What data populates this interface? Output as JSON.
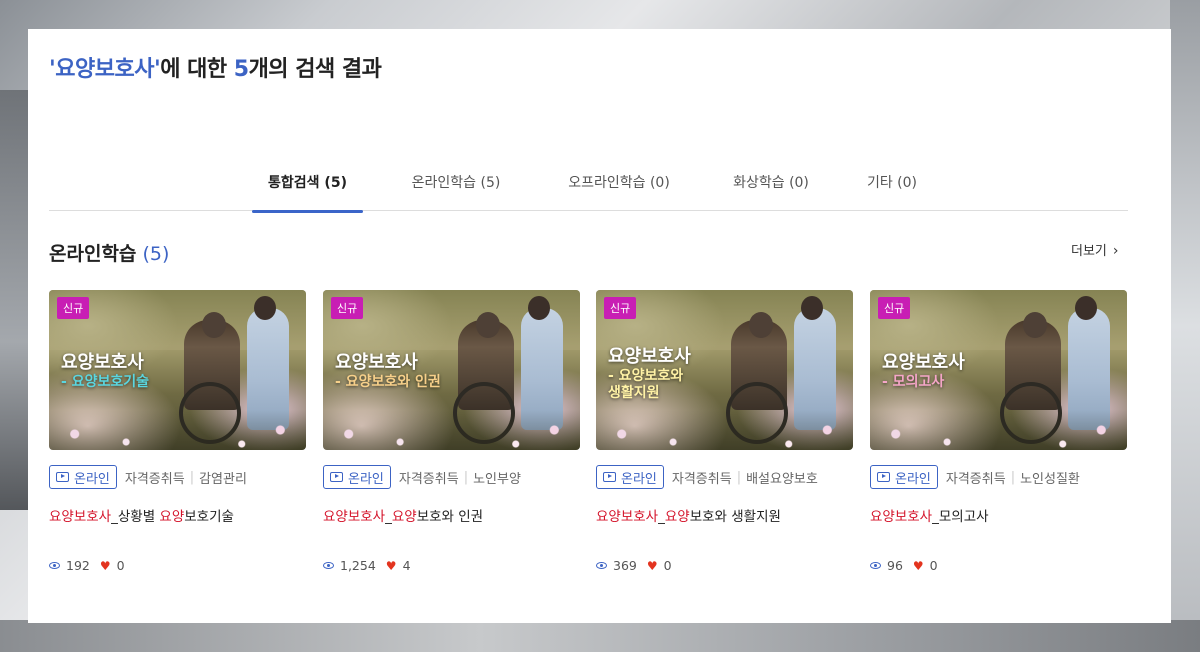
{
  "search": {
    "quote_open": "'",
    "keyword": "요양보호사",
    "quote_close": "'",
    "suffix_a": "에 대한 ",
    "count": "5",
    "suffix_b": "개의 검색 결과"
  },
  "tabs": [
    {
      "label": "통합검색 (5)",
      "active": true
    },
    {
      "label": "온라인학습 (5)",
      "active": false
    },
    {
      "label": "오프라인학습 (0)",
      "active": false
    },
    {
      "label": "화상학습 (0)",
      "active": false
    },
    {
      "label": "기타 (0)",
      "active": false
    }
  ],
  "section": {
    "title": "온라인학습",
    "count_open": " (",
    "count": "5",
    "count_close": ")",
    "more_label": "더보기",
    "more_icon": "chevron-right-icon"
  },
  "cards": [
    {
      "badge": "신규",
      "thumb_title": "요양보호사",
      "thumb_sub": "- 요양보호기술",
      "tag": "온라인",
      "category": "자격증취득",
      "subcategory": "감염관리",
      "title_hl1": "요양보호사",
      "title_mid": "_상황별 ",
      "title_hl2": "요양",
      "title_end": "보호기술",
      "views": "192",
      "likes": "0"
    },
    {
      "badge": "신규",
      "thumb_title": "요양보호사",
      "thumb_sub": "- 요양보호와 인권",
      "tag": "온라인",
      "category": "자격증취득",
      "subcategory": "노인부양",
      "title_hl1": "요양보호사",
      "title_mid": "_",
      "title_hl2": "요양",
      "title_end": "보호와 인권",
      "views": "1,254",
      "likes": "4"
    },
    {
      "badge": "신규",
      "thumb_title": "요양보호사",
      "thumb_sub": "- 요양보호와\n  생활지원",
      "tag": "온라인",
      "category": "자격증취득",
      "subcategory": "배설요양보호",
      "title_hl1": "요양보호사",
      "title_mid": "_",
      "title_hl2": "요양",
      "title_end": "보호와 생활지원",
      "views": "369",
      "likes": "0"
    },
    {
      "badge": "신규",
      "thumb_title": "요양보호사",
      "thumb_sub": "- 모의고사",
      "tag": "온라인",
      "category": "자격증취득",
      "subcategory": "노인성질환",
      "title_hl1": "요양보호사",
      "title_mid": "_모의고사",
      "title_hl2": "",
      "title_end": "",
      "views": "96",
      "likes": "0"
    }
  ],
  "colors": {
    "accent": "#3c63c4",
    "highlight_red": "#d4132a",
    "badge_magenta": "#c81eb4",
    "heart": "#e3341f"
  }
}
